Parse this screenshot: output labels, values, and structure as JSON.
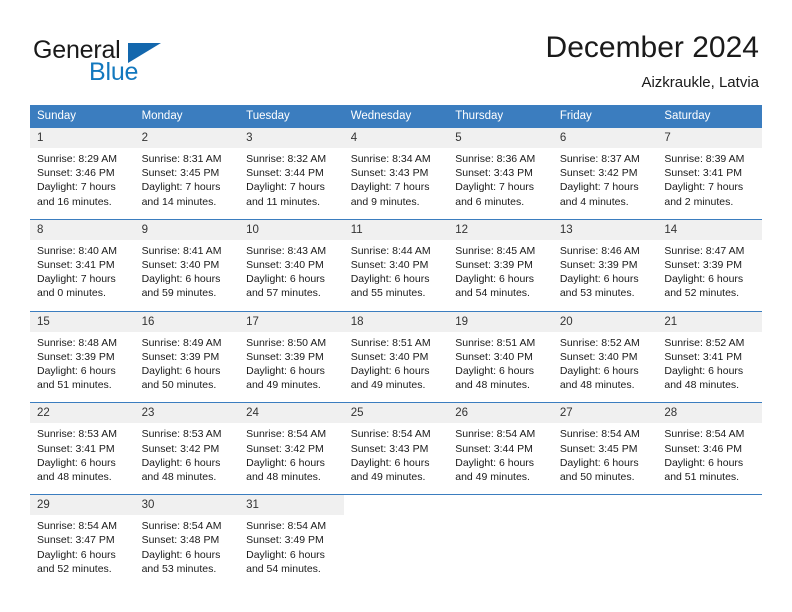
{
  "brand": {
    "name_part1": "General",
    "name_part2": "Blue",
    "logo_icon": "blue-triangle-icon"
  },
  "header": {
    "month_title": "December 2024",
    "location": "Aizkraukle, Latvia"
  },
  "colors": {
    "header_blue": "#3b7dbf",
    "brand_blue": "#1278be",
    "logo_blue": "#1367ad",
    "daynum_band": "#f0f0f0",
    "text": "#1a1a1a"
  },
  "weekdays": [
    "Sunday",
    "Monday",
    "Tuesday",
    "Wednesday",
    "Thursday",
    "Friday",
    "Saturday"
  ],
  "labels": {
    "sunrise_prefix": "Sunrise:",
    "sunset_prefix": "Sunset:",
    "daylight_prefix": "Daylight:"
  },
  "weeks": [
    [
      {
        "day": "1",
        "sunrise": "Sunrise: 8:29 AM",
        "sunset": "Sunset: 3:46 PM",
        "daylight1": "Daylight: 7 hours",
        "daylight2": "and 16 minutes."
      },
      {
        "day": "2",
        "sunrise": "Sunrise: 8:31 AM",
        "sunset": "Sunset: 3:45 PM",
        "daylight1": "Daylight: 7 hours",
        "daylight2": "and 14 minutes."
      },
      {
        "day": "3",
        "sunrise": "Sunrise: 8:32 AM",
        "sunset": "Sunset: 3:44 PM",
        "daylight1": "Daylight: 7 hours",
        "daylight2": "and 11 minutes."
      },
      {
        "day": "4",
        "sunrise": "Sunrise: 8:34 AM",
        "sunset": "Sunset: 3:43 PM",
        "daylight1": "Daylight: 7 hours",
        "daylight2": "and 9 minutes."
      },
      {
        "day": "5",
        "sunrise": "Sunrise: 8:36 AM",
        "sunset": "Sunset: 3:43 PM",
        "daylight1": "Daylight: 7 hours",
        "daylight2": "and 6 minutes."
      },
      {
        "day": "6",
        "sunrise": "Sunrise: 8:37 AM",
        "sunset": "Sunset: 3:42 PM",
        "daylight1": "Daylight: 7 hours",
        "daylight2": "and 4 minutes."
      },
      {
        "day": "7",
        "sunrise": "Sunrise: 8:39 AM",
        "sunset": "Sunset: 3:41 PM",
        "daylight1": "Daylight: 7 hours",
        "daylight2": "and 2 minutes."
      }
    ],
    [
      {
        "day": "8",
        "sunrise": "Sunrise: 8:40 AM",
        "sunset": "Sunset: 3:41 PM",
        "daylight1": "Daylight: 7 hours",
        "daylight2": "and 0 minutes."
      },
      {
        "day": "9",
        "sunrise": "Sunrise: 8:41 AM",
        "sunset": "Sunset: 3:40 PM",
        "daylight1": "Daylight: 6 hours",
        "daylight2": "and 59 minutes."
      },
      {
        "day": "10",
        "sunrise": "Sunrise: 8:43 AM",
        "sunset": "Sunset: 3:40 PM",
        "daylight1": "Daylight: 6 hours",
        "daylight2": "and 57 minutes."
      },
      {
        "day": "11",
        "sunrise": "Sunrise: 8:44 AM",
        "sunset": "Sunset: 3:40 PM",
        "daylight1": "Daylight: 6 hours",
        "daylight2": "and 55 minutes."
      },
      {
        "day": "12",
        "sunrise": "Sunrise: 8:45 AM",
        "sunset": "Sunset: 3:39 PM",
        "daylight1": "Daylight: 6 hours",
        "daylight2": "and 54 minutes."
      },
      {
        "day": "13",
        "sunrise": "Sunrise: 8:46 AM",
        "sunset": "Sunset: 3:39 PM",
        "daylight1": "Daylight: 6 hours",
        "daylight2": "and 53 minutes."
      },
      {
        "day": "14",
        "sunrise": "Sunrise: 8:47 AM",
        "sunset": "Sunset: 3:39 PM",
        "daylight1": "Daylight: 6 hours",
        "daylight2": "and 52 minutes."
      }
    ],
    [
      {
        "day": "15",
        "sunrise": "Sunrise: 8:48 AM",
        "sunset": "Sunset: 3:39 PM",
        "daylight1": "Daylight: 6 hours",
        "daylight2": "and 51 minutes."
      },
      {
        "day": "16",
        "sunrise": "Sunrise: 8:49 AM",
        "sunset": "Sunset: 3:39 PM",
        "daylight1": "Daylight: 6 hours",
        "daylight2": "and 50 minutes."
      },
      {
        "day": "17",
        "sunrise": "Sunrise: 8:50 AM",
        "sunset": "Sunset: 3:39 PM",
        "daylight1": "Daylight: 6 hours",
        "daylight2": "and 49 minutes."
      },
      {
        "day": "18",
        "sunrise": "Sunrise: 8:51 AM",
        "sunset": "Sunset: 3:40 PM",
        "daylight1": "Daylight: 6 hours",
        "daylight2": "and 49 minutes."
      },
      {
        "day": "19",
        "sunrise": "Sunrise: 8:51 AM",
        "sunset": "Sunset: 3:40 PM",
        "daylight1": "Daylight: 6 hours",
        "daylight2": "and 48 minutes."
      },
      {
        "day": "20",
        "sunrise": "Sunrise: 8:52 AM",
        "sunset": "Sunset: 3:40 PM",
        "daylight1": "Daylight: 6 hours",
        "daylight2": "and 48 minutes."
      },
      {
        "day": "21",
        "sunrise": "Sunrise: 8:52 AM",
        "sunset": "Sunset: 3:41 PM",
        "daylight1": "Daylight: 6 hours",
        "daylight2": "and 48 minutes."
      }
    ],
    [
      {
        "day": "22",
        "sunrise": "Sunrise: 8:53 AM",
        "sunset": "Sunset: 3:41 PM",
        "daylight1": "Daylight: 6 hours",
        "daylight2": "and 48 minutes."
      },
      {
        "day": "23",
        "sunrise": "Sunrise: 8:53 AM",
        "sunset": "Sunset: 3:42 PM",
        "daylight1": "Daylight: 6 hours",
        "daylight2": "and 48 minutes."
      },
      {
        "day": "24",
        "sunrise": "Sunrise: 8:54 AM",
        "sunset": "Sunset: 3:42 PM",
        "daylight1": "Daylight: 6 hours",
        "daylight2": "and 48 minutes."
      },
      {
        "day": "25",
        "sunrise": "Sunrise: 8:54 AM",
        "sunset": "Sunset: 3:43 PM",
        "daylight1": "Daylight: 6 hours",
        "daylight2": "and 49 minutes."
      },
      {
        "day": "26",
        "sunrise": "Sunrise: 8:54 AM",
        "sunset": "Sunset: 3:44 PM",
        "daylight1": "Daylight: 6 hours",
        "daylight2": "and 49 minutes."
      },
      {
        "day": "27",
        "sunrise": "Sunrise: 8:54 AM",
        "sunset": "Sunset: 3:45 PM",
        "daylight1": "Daylight: 6 hours",
        "daylight2": "and 50 minutes."
      },
      {
        "day": "28",
        "sunrise": "Sunrise: 8:54 AM",
        "sunset": "Sunset: 3:46 PM",
        "daylight1": "Daylight: 6 hours",
        "daylight2": "and 51 minutes."
      }
    ],
    [
      {
        "day": "29",
        "sunrise": "Sunrise: 8:54 AM",
        "sunset": "Sunset: 3:47 PM",
        "daylight1": "Daylight: 6 hours",
        "daylight2": "and 52 minutes."
      },
      {
        "day": "30",
        "sunrise": "Sunrise: 8:54 AM",
        "sunset": "Sunset: 3:48 PM",
        "daylight1": "Daylight: 6 hours",
        "daylight2": "and 53 minutes."
      },
      {
        "day": "31",
        "sunrise": "Sunrise: 8:54 AM",
        "sunset": "Sunset: 3:49 PM",
        "daylight1": "Daylight: 6 hours",
        "daylight2": "and 54 minutes."
      },
      {
        "day": "",
        "sunrise": "",
        "sunset": "",
        "daylight1": "",
        "daylight2": ""
      },
      {
        "day": "",
        "sunrise": "",
        "sunset": "",
        "daylight1": "",
        "daylight2": ""
      },
      {
        "day": "",
        "sunrise": "",
        "sunset": "",
        "daylight1": "",
        "daylight2": ""
      },
      {
        "day": "",
        "sunrise": "",
        "sunset": "",
        "daylight1": "",
        "daylight2": ""
      }
    ]
  ]
}
